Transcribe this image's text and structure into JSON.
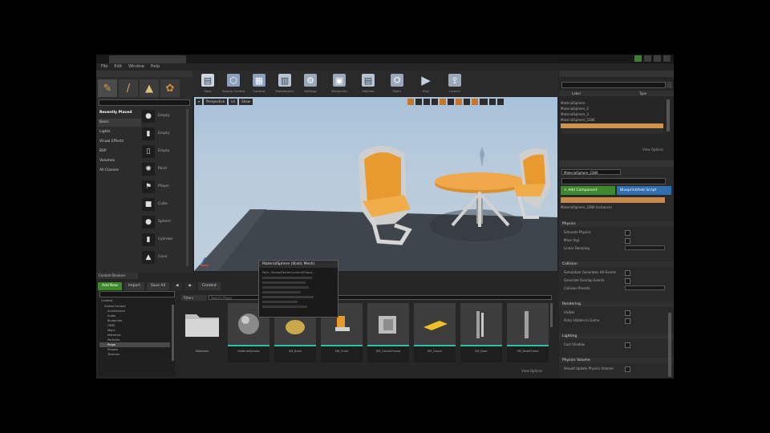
{
  "window": {
    "title": "",
    "menu": [
      "File",
      "Edit",
      "Window",
      "Help"
    ]
  },
  "modes": {
    "search_placeholder": "",
    "categories": [
      "Recently Placed",
      "Basic",
      "Lights",
      "Visual Effects",
      "BSP",
      "Volumes",
      "All Classes"
    ],
    "items": [
      "Empty",
      "Empty",
      "Empty",
      "Point",
      "Player",
      "Cube",
      "Sphere",
      "Cylinder",
      "Cone"
    ]
  },
  "toolbar": {
    "buttons": [
      {
        "label": "Save",
        "icon": "save-icon",
        "color": "#cfd6e0"
      },
      {
        "label": "Source Control",
        "icon": "source-control-icon",
        "color": "#8aa0bd"
      },
      {
        "label": "Content",
        "icon": "content-icon",
        "color": "#8aa0bd"
      },
      {
        "label": "Marketplace",
        "icon": "marketplace-icon",
        "color": "#b8c4d4"
      },
      {
        "label": "Settings",
        "icon": "settings-icon",
        "color": "#9aa8bc"
      },
      {
        "label": "Blueprints",
        "icon": "blueprints-icon",
        "color": "#9aa8bc"
      },
      {
        "label": "Matinee",
        "icon": "matinee-icon",
        "color": "#b8c4d4"
      },
      {
        "label": "Build",
        "icon": "build-icon",
        "color": "#9aa8bc"
      },
      {
        "label": "Play",
        "icon": "play-icon",
        "color": "#c4d0e0"
      },
      {
        "label": "Launch",
        "icon": "launch-icon",
        "color": "#9aa8bc"
      }
    ]
  },
  "viewport": {
    "perspective_label": "Perspective",
    "lit_label": "Lit",
    "show_label": "Show",
    "accent": "#c7762a"
  },
  "outliner": {
    "search_placeholder": "",
    "col_label": "Label",
    "col_type": "Type",
    "rows": [
      "MaterialSphere",
      "MaterialSphere_2",
      "MaterialSphere_3",
      "MaterialSphere_2386"
    ],
    "footer": "",
    "view_options": "View Options"
  },
  "details": {
    "name_value": "MaterialSphere_2386",
    "add_component": "+ Add Component",
    "blueprint_add": "Blueprint/Add Script",
    "component_row": "MaterialSphere_2386 (Instance)",
    "sections": [
      {
        "title": "Physics",
        "rows": [
          "Simulate Physics",
          "Mass (kg)",
          "Linear Damping"
        ]
      },
      {
        "title": "Collision",
        "rows": [
          "Simulation Generates Hit Events",
          "Generate Overlap Events",
          "Collision Presets"
        ]
      },
      {
        "title": "Rendering",
        "rows": [
          "Visible",
          "Actor Hidden In Game"
        ]
      },
      {
        "title": "Lighting",
        "rows": [
          "Cast Shadow"
        ]
      },
      {
        "title": "Physics Volume",
        "rows": [
          "Should Update Physics Volume"
        ]
      }
    ]
  },
  "content": {
    "tab_label": "Content Browser",
    "add_new": "Add New",
    "import": "Import",
    "save_all": "Save All",
    "path": "Content",
    "filters": "Filters",
    "search_placeholder": "Search Props",
    "tree": [
      "Content",
      "StarterContent",
      "Architecture",
      "Audio",
      "Blueprints",
      "HDRI",
      "Maps",
      "Materials",
      "Particles",
      "Props",
      "Shapes",
      "Textures"
    ],
    "assets": [
      {
        "name": "Materials",
        "icon": "folder-icon"
      },
      {
        "name": "MaterialSphere",
        "icon": "sphere-icon"
      },
      {
        "name": "SM_Bush",
        "icon": "bush-icon"
      },
      {
        "name": "SM_Chair",
        "icon": "chair-icon"
      },
      {
        "name": "SM_CornerFrame",
        "icon": "frame-icon"
      },
      {
        "name": "SM_Couch",
        "icon": "couch-icon"
      },
      {
        "name": "SM_Door",
        "icon": "door-icon"
      },
      {
        "name": "SM_DoorFrame",
        "icon": "doorframe-icon"
      }
    ],
    "footer_count": "",
    "view_options": "View Options"
  },
  "tooltip": {
    "title": "MaterialSphere (Static Mesh)",
    "lines": [
      "Path: /Game/StarterContent/Props/..."
    ]
  }
}
